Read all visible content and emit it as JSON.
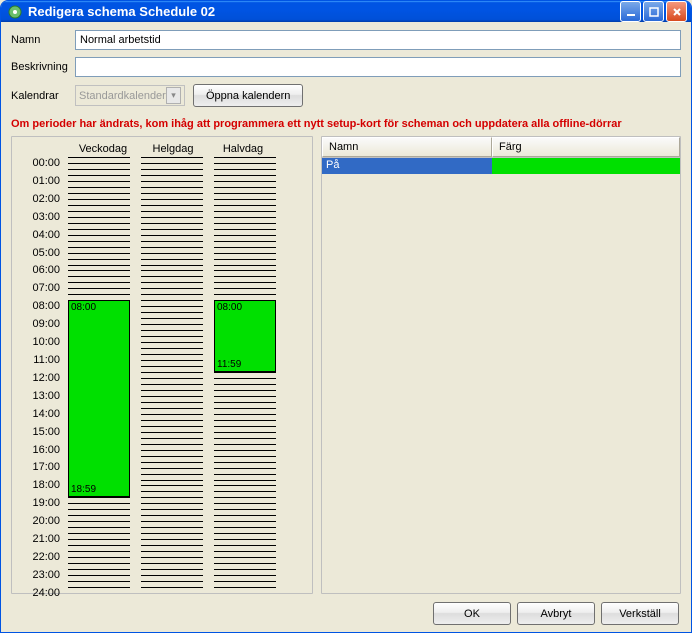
{
  "window": {
    "title": "Redigera schema Schedule 02"
  },
  "form": {
    "name_label": "Namn",
    "name_value": "Normal arbetstid",
    "desc_label": "Beskrivning",
    "desc_value": "",
    "cal_label": "Kalendrar",
    "calendar_select": "Standardkalender",
    "open_calendar_btn": "Öppna kalendern"
  },
  "warning": "Om perioder har ändrats, kom ihåg att programmera ett nytt setup-kort för scheman och uppdatera alla offline-dörrar",
  "columns": [
    "Veckodag",
    "Helgdag",
    "Halvdag"
  ],
  "hours": [
    "00:00",
    "01:00",
    "02:00",
    "03:00",
    "04:00",
    "05:00",
    "06:00",
    "07:00",
    "08:00",
    "09:00",
    "10:00",
    "11:00",
    "12:00",
    "13:00",
    "14:00",
    "15:00",
    "16:00",
    "17:00",
    "18:00",
    "19:00",
    "20:00",
    "21:00",
    "22:00",
    "23:00",
    "24:00"
  ],
  "periods": {
    "veckodag": {
      "start": "08:00",
      "end": "18:59"
    },
    "halvdag": {
      "start": "08:00",
      "end": "11:59"
    }
  },
  "table": {
    "head_name": "Namn",
    "head_color": "Färg",
    "rows": [
      {
        "name": "På",
        "color": "#00e000"
      }
    ]
  },
  "buttons": {
    "ok": "OK",
    "cancel": "Avbryt",
    "apply": "Verkställ"
  }
}
